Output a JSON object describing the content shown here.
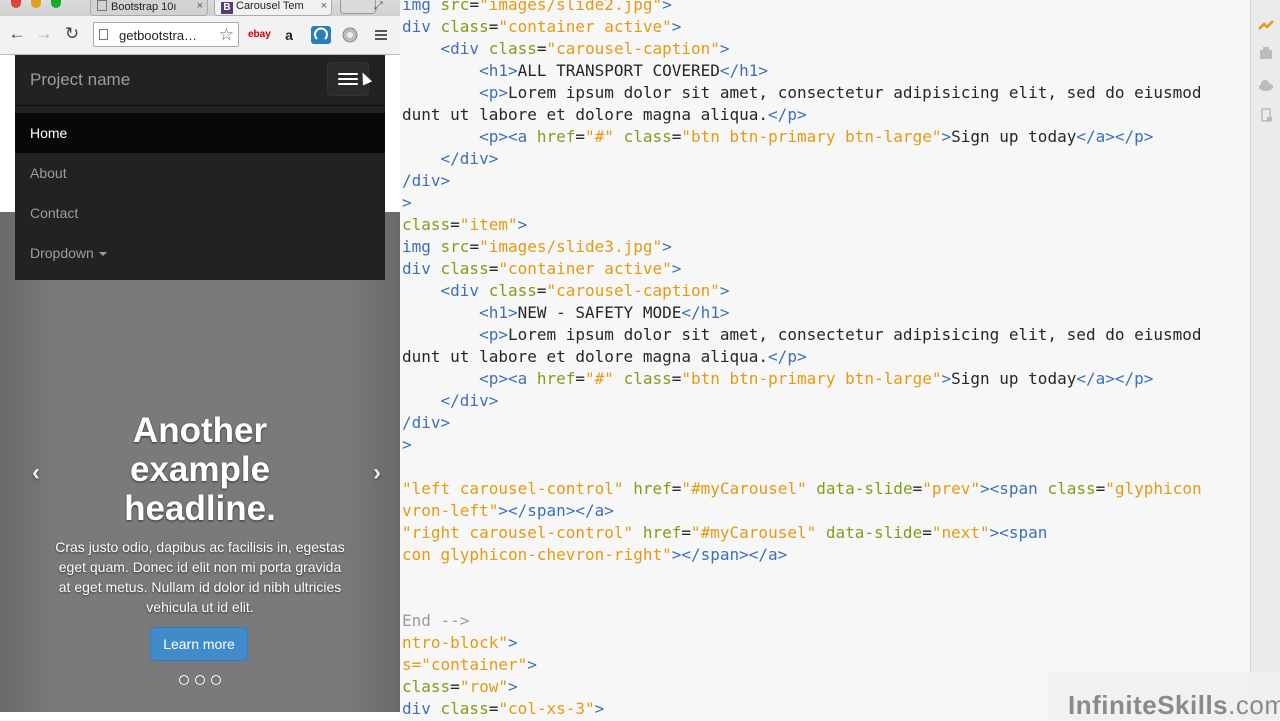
{
  "browser": {
    "tabs": [
      {
        "label": "Bootstrap 10ı",
        "close": "×"
      },
      {
        "label": "Carousel Tem",
        "close": "×"
      }
    ],
    "url": "getbootstra…",
    "extensions": [
      "ebay",
      "a"
    ]
  },
  "site": {
    "brand": "Project name",
    "nav": [
      {
        "label": "Home",
        "active": true
      },
      {
        "label": "About",
        "active": false
      },
      {
        "label": "Contact",
        "active": false
      },
      {
        "label": "Dropdown",
        "active": false
      }
    ],
    "carousel": {
      "headline": "Another example headline.",
      "lead": "Cras justo odio, dapibus ac facilisis in, egestas eget quam. Donec id elit non mi porta gravida at eget metus. Nullam id dolor id nibh ultricies vehicula ut id elit.",
      "button": "Learn more",
      "prev": "‹",
      "next": "›",
      "slide_count": 3,
      "active_slide": 2
    }
  },
  "editor": {
    "lines": [
      [
        [
          "t",
          "img "
        ],
        [
          "a",
          "src"
        ],
        [
          "x",
          "="
        ],
        [
          "s",
          "\"images/slide2.jpg\""
        ],
        [
          "t",
          ">"
        ]
      ],
      [
        [
          "t",
          "div "
        ],
        [
          "a",
          "class"
        ],
        [
          "x",
          "="
        ],
        [
          "s",
          "\"container active\""
        ],
        [
          "t",
          ">"
        ]
      ],
      [
        [
          "x",
          "    "
        ],
        [
          "t",
          "<div "
        ],
        [
          "a",
          "class"
        ],
        [
          "x",
          "="
        ],
        [
          "s",
          "\"carousel-caption\""
        ],
        [
          "t",
          ">"
        ]
      ],
      [
        [
          "x",
          "        "
        ],
        [
          "t",
          "<h1>"
        ],
        [
          "x",
          "ALL TRANSPORT COVERED"
        ],
        [
          "t",
          "</h1>"
        ]
      ],
      [
        [
          "x",
          "        "
        ],
        [
          "t",
          "<p>"
        ],
        [
          "x",
          "Lorem ipsum dolor sit amet, consectetur adipisicing elit, sed do eiusmod"
        ]
      ],
      [
        [
          "x",
          "dunt ut labore et dolore magna aliqua."
        ],
        [
          "t",
          "</p>"
        ]
      ],
      [
        [
          "x",
          "        "
        ],
        [
          "t",
          "<p><a "
        ],
        [
          "a",
          "href"
        ],
        [
          "x",
          "="
        ],
        [
          "s",
          "\"#\""
        ],
        [
          "a",
          " class"
        ],
        [
          "x",
          "="
        ],
        [
          "s",
          "\"btn btn-primary btn-large\""
        ],
        [
          "t",
          ">"
        ],
        [
          "x",
          "Sign up today"
        ],
        [
          "t",
          "</a></p>"
        ]
      ],
      [
        [
          "x",
          "    "
        ],
        [
          "t",
          "</div>"
        ]
      ],
      [
        [
          "t",
          "/div>"
        ]
      ],
      [
        [
          "t",
          ">"
        ]
      ],
      [
        [
          "a",
          "class"
        ],
        [
          "x",
          "="
        ],
        [
          "s",
          "\"item\""
        ],
        [
          "t",
          ">"
        ]
      ],
      [
        [
          "t",
          "img "
        ],
        [
          "a",
          "src"
        ],
        [
          "x",
          "="
        ],
        [
          "s",
          "\"images/slide3.jpg\""
        ],
        [
          "t",
          ">"
        ]
      ],
      [
        [
          "t",
          "div "
        ],
        [
          "a",
          "class"
        ],
        [
          "x",
          "="
        ],
        [
          "s",
          "\"container active\""
        ],
        [
          "t",
          ">"
        ]
      ],
      [
        [
          "x",
          "    "
        ],
        [
          "t",
          "<div "
        ],
        [
          "a",
          "class"
        ],
        [
          "x",
          "="
        ],
        [
          "s",
          "\"carousel-caption\""
        ],
        [
          "t",
          ">"
        ]
      ],
      [
        [
          "x",
          "        "
        ],
        [
          "t",
          "<h1>"
        ],
        [
          "x",
          "NEW - SAFETY MODE"
        ],
        [
          "t",
          "</h1>"
        ]
      ],
      [
        [
          "x",
          "        "
        ],
        [
          "t",
          "<p>"
        ],
        [
          "x",
          "Lorem ipsum dolor sit amet, consectetur adipisicing elit, sed do eiusmod"
        ]
      ],
      [
        [
          "x",
          "dunt ut labore et dolore magna aliqua."
        ],
        [
          "t",
          "</p>"
        ]
      ],
      [
        [
          "x",
          "        "
        ],
        [
          "t",
          "<p><a "
        ],
        [
          "a",
          "href"
        ],
        [
          "x",
          "="
        ],
        [
          "s",
          "\"#\""
        ],
        [
          "a",
          " class"
        ],
        [
          "x",
          "="
        ],
        [
          "s",
          "\"btn btn-primary btn-large\""
        ],
        [
          "t",
          ">"
        ],
        [
          "x",
          "Sign up today"
        ],
        [
          "t",
          "</a></p>"
        ]
      ],
      [
        [
          "x",
          "    "
        ],
        [
          "t",
          "</div>"
        ]
      ],
      [
        [
          "t",
          "/div>"
        ]
      ],
      [
        [
          "t",
          ">"
        ]
      ],
      [],
      [
        [
          "s",
          "\"left carousel-control\""
        ],
        [
          "a",
          " href"
        ],
        [
          "x",
          "="
        ],
        [
          "s",
          "\"#myCarousel\""
        ],
        [
          "a",
          " data-slide"
        ],
        [
          "x",
          "="
        ],
        [
          "s",
          "\"prev\""
        ],
        [
          "t",
          "><span "
        ],
        [
          "a",
          "class"
        ],
        [
          "x",
          "="
        ],
        [
          "s",
          "\"glyphicon"
        ]
      ],
      [
        [
          "s",
          "vron-left\""
        ],
        [
          "t",
          "></span></a>"
        ]
      ],
      [
        [
          "s",
          "\"right carousel-control\""
        ],
        [
          "a",
          " href"
        ],
        [
          "x",
          "="
        ],
        [
          "s",
          "\"#myCarousel\""
        ],
        [
          "a",
          " data-slide"
        ],
        [
          "x",
          "="
        ],
        [
          "s",
          "\"next\""
        ],
        [
          "t",
          "><span"
        ]
      ],
      [
        [
          "s",
          "con glyphicon-chevron-right\""
        ],
        [
          "t",
          "></span></a>"
        ]
      ],
      [],
      [],
      [
        [
          "c",
          "End -->"
        ]
      ],
      [
        [
          "s",
          "ntro-block\""
        ],
        [
          "t",
          ">"
        ]
      ],
      [
        [
          "s",
          "s=\"container\""
        ],
        [
          "t",
          ">"
        ]
      ],
      [
        [
          "a",
          "class"
        ],
        [
          "x",
          "="
        ],
        [
          "s",
          "\"row\""
        ],
        [
          "t",
          ">"
        ]
      ],
      [
        [
          "t",
          "div "
        ],
        [
          "a",
          "class"
        ],
        [
          "x",
          "="
        ],
        [
          "s",
          "\"col-xs-3\""
        ],
        [
          "t",
          ">"
        ]
      ]
    ]
  },
  "watermark": {
    "name": "InfiniteSkills",
    "domain": ".com"
  },
  "colors": {
    "tag": "#3e70b8",
    "attr": "#7e9f17",
    "string": "#e49a12",
    "text": "#262626",
    "comment": "#9a9a9a",
    "accent": "#428bca"
  }
}
